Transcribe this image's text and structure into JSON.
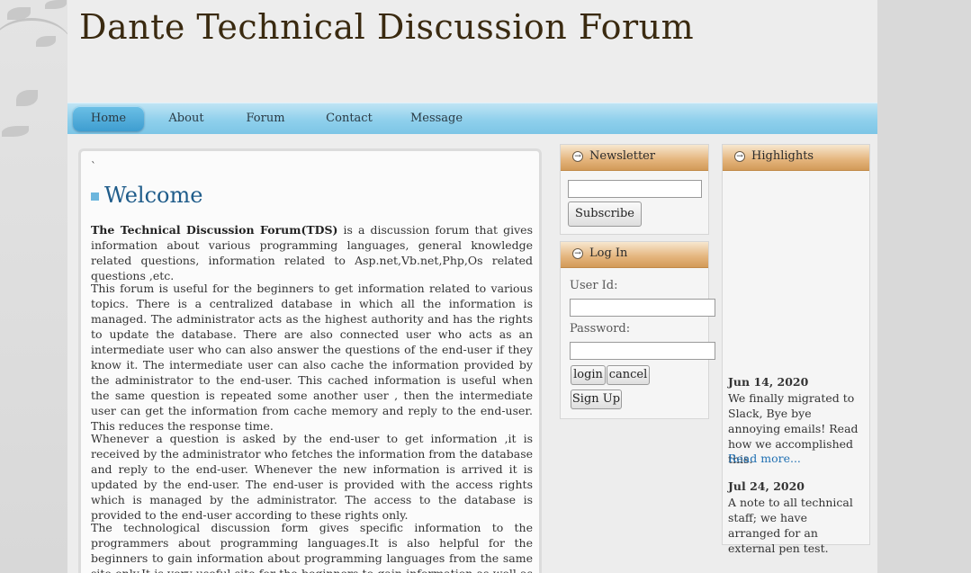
{
  "site": {
    "title": "Dante Technical Discussion Forum"
  },
  "nav": {
    "items": [
      "Home",
      "About",
      "Forum",
      "Contact",
      "Message"
    ]
  },
  "main": {
    "tick": "`",
    "welcome_title": "Welcome",
    "intro_bold": "The Technical Discussion Forum(TDS)",
    "intro_rest": " is a discussion forum that gives information about various programming languages, general knowledge related questions, information related to Asp.net,Vb.net,Php,Os related questions ,etc.",
    "para2": "This forum is useful for the beginners to get information related to various topics. There is a centralized database in which all the information is managed. The administrator acts as the highest authority and has the rights to update the database. There are also connected user who acts as an intermediate user who can also answer the questions of the end-user if they know it. The intermediate user can also cache the information provided by the administrator to the end-user. This cached information is useful when the same question is repeated some another user , then the intermediate user can get the information from cache memory and reply to the end-user. This reduces the response time.",
    "para3": "Whenever a question is asked by the end-user to get information ,it is received by the administrator who fetches the information from the database and reply to the end-user. Whenever the new information is arrived it is updated by the end-user. The end-user is provided with the access rights which is managed by the administrator. The access to the database is provided to the end-user according to these rights only.",
    "para4": "The technological discussion form gives specific information to the programmers about programming languages.It is also helpful for the beginners to gain information about programming languages from the same site only.It is very useful site for the beginners to gain information as well as learn new programming languages very easily.The goal"
  },
  "newsletter": {
    "heading": "Newsletter",
    "email_value": "",
    "subscribe_label": "Subscribe"
  },
  "login": {
    "heading": "Log In",
    "user_label": "User Id:",
    "user_value": "",
    "password_label": "Password:",
    "password_value": "",
    "login_label": "login",
    "cancel_label": "cancel",
    "signup_label": "Sign Up"
  },
  "highlights": {
    "heading": "Highlights",
    "items": [
      {
        "date": "Jun 14, 2020",
        "text": "We finally migrated to Slack, Bye bye annoying emails! Read how we accomplished this.",
        "link": "Read more..."
      },
      {
        "date": "Jul 24, 2020",
        "text": "A note to all technical staff; we have arranged for an external pen test."
      }
    ]
  },
  "colors": {
    "nav": "#8fd0ec",
    "accent": "#1f5c8a",
    "box_header": "#e4b47c",
    "link": "#1f6fb2"
  }
}
